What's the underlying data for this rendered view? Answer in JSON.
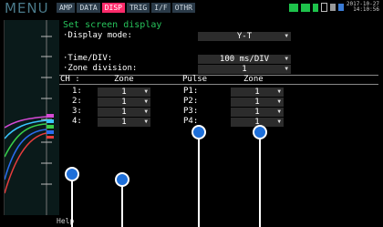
{
  "header": {
    "menu": "MENU",
    "tabs": [
      "AMP",
      "DATA",
      "DISP",
      "TRIG",
      "I/F",
      "OTHR"
    ],
    "date": "2017-10-27",
    "time": "14:10:56"
  },
  "panel": {
    "title": "Set screen display",
    "display_mode": {
      "label": "·Display mode:",
      "value": "Y-T"
    },
    "time_div": {
      "label": "·Time/DIV:",
      "value": "100 ms/DIV"
    },
    "zone_division": {
      "label": "·Zone division:",
      "value": "1"
    },
    "table": {
      "headers": [
        "CH :",
        "Zone",
        "Pulse",
        "Zone"
      ],
      "rows": [
        {
          "ch": "1:",
          "zone": "1",
          "pulse": "P1:",
          "pzone": "1"
        },
        {
          "ch": "2:",
          "zone": "1",
          "pulse": "P2:",
          "pzone": "1"
        },
        {
          "ch": "3:",
          "zone": "1",
          "pulse": "P3:",
          "pzone": "1"
        },
        {
          "ch": "4:",
          "zone": "1",
          "pulse": "P4:",
          "pzone": "1"
        }
      ]
    }
  },
  "footer": {
    "help": "Help"
  },
  "colors": {
    "title_green": "#27c45c",
    "active_tab": "#ff2a6a",
    "pin_blue": "#1e6fd9"
  }
}
